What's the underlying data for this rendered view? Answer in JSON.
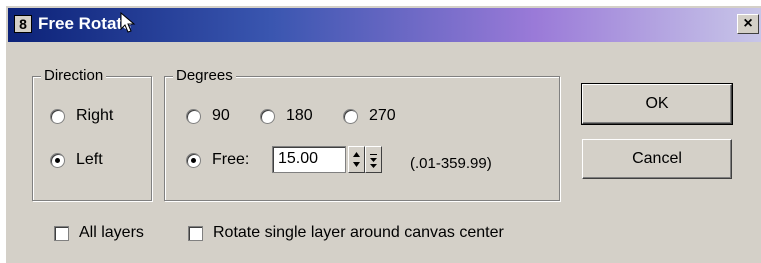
{
  "window": {
    "icon_label": "8",
    "title": "Free Rotate",
    "close_label": "×"
  },
  "direction": {
    "legend": "Direction",
    "options": [
      {
        "label": "Right",
        "selected": false
      },
      {
        "label": "Left",
        "selected": true
      }
    ]
  },
  "degrees": {
    "legend": "Degrees",
    "presets": [
      {
        "label": "90",
        "selected": false
      },
      {
        "label": "180",
        "selected": false
      },
      {
        "label": "270",
        "selected": false
      }
    ],
    "free": {
      "label": "Free:",
      "selected": true,
      "value": "15.00",
      "range_hint": "(.01-359.99)"
    }
  },
  "options": [
    {
      "label": "All layers",
      "checked": false
    },
    {
      "label": "Rotate single layer around canvas center",
      "checked": false
    }
  ],
  "buttons": {
    "ok": "OK",
    "cancel": "Cancel"
  }
}
